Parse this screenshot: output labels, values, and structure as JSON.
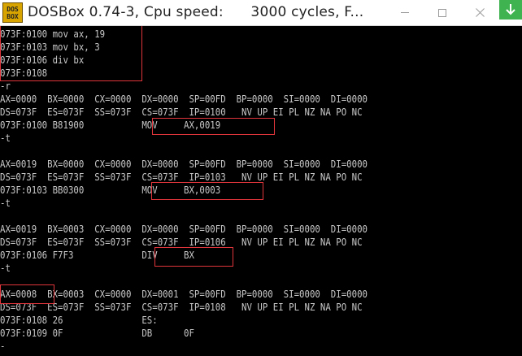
{
  "window": {
    "title": "DOSBox 0.74-3, Cpu speed:      3000 cycles, F...",
    "icon_text_top": "DOS",
    "icon_text_bottom": "BOX",
    "icon_name": "dosbox-app-icon",
    "controls": {
      "minimize": "minimize-icon",
      "maximize": "maximize-icon",
      "close": "close-icon"
    },
    "download_badge_icon": "download-arrow-icon"
  },
  "console": {
    "lines": [
      "073F:0100 mov ax, 19",
      "073F:0103 mov bx, 3",
      "073F:0106 div bx",
      "073F:0108",
      "-r",
      "AX=0000  BX=0000  CX=0000  DX=0000  SP=00FD  BP=0000  SI=0000  DI=0000",
      "DS=073F  ES=073F  SS=073F  CS=073F  IP=0100   NV UP EI PL NZ NA PO NC",
      "073F:0100 B81900           MOV     AX,0019",
      "-t",
      "",
      "AX=0019  BX=0000  CX=0000  DX=0000  SP=00FD  BP=0000  SI=0000  DI=0000",
      "DS=073F  ES=073F  SS=073F  CS=073F  IP=0103   NV UP EI PL NZ NA PO NC",
      "073F:0103 BB0300           MOV     BX,0003",
      "-t",
      "",
      "AX=0019  BX=0003  CX=0000  DX=0000  SP=00FD  BP=0000  SI=0000  DI=0000",
      "DS=073F  ES=073F  SS=073F  CS=073F  IP=0106   NV UP EI PL NZ NA PO NC",
      "073F:0106 F7F3             DIV     BX",
      "-t",
      "",
      "AX=0008  BX=0003  CX=0000  DX=0001  SP=00FD  BP=0000  SI=0000  DI=0000",
      "DS=073F  ES=073F  SS=073F  CS=073F  IP=0108   NV UP EI PL NZ NA PO NC",
      "073F:0108 26               ES:",
      "073F:0109 0F               DB      0F",
      "-"
    ]
  },
  "colors": {
    "console_bg": "#000000",
    "console_text": "#c8c8c8",
    "highlight_border": "#e0353b",
    "titlebar_bg": "#ffffff",
    "download_badge": "#3fb34f"
  }
}
